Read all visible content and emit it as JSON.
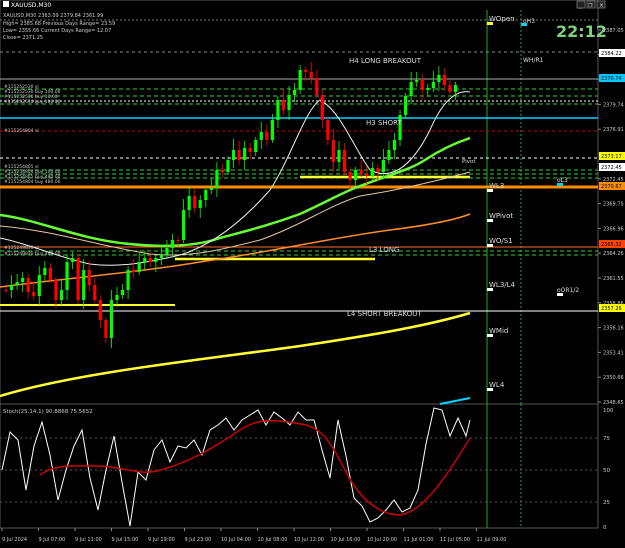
{
  "window": {
    "title": "XAUUSD,M30",
    "close_label": "×",
    "restore_label": "❐",
    "minimize_label": "_"
  },
  "info_lines": [
    "XAUUSD,M30  2363.09 2379.84 2361.99",
    "High= 2385.68   Previous Days Range= 23.59",
    "Low= 2355.66   Current Days Range= 12.07",
    "Close= 2371.25"
  ],
  "clock": "22:12",
  "chart_text": {
    "h4_long": "H4 LONG BREAKOUT",
    "h3_short": "H3 SHORT",
    "l3_long": "L3 LONG",
    "l4_short": "L4 SHORT BREAKOUT",
    "pivot": "Pivot",
    "wopen": "WOpen",
    "oh3": "oH3",
    "wh_r1": "WH/R1",
    "ol3": "oL3",
    "wl3": "WL3",
    "wpivot": "WPivot",
    "wo_s1": "WO/S1",
    "wl3_l4": "WL3/L4",
    "or1_2": "oOR1/2",
    "wmid": "WMid",
    "wl4": "WL4"
  },
  "orders": [
    "#115252530 sl",
    "#115252530 buy 100.00",
    "#115252530 buy 10.00",
    "#115252530 buy 100.00",
    "#115254804 sl",
    "#115254805 sl",
    "#115254804 buy 100.00",
    "#115254805 buy 480.00",
    "#115254804 buy 480.00",
    "#115249830 sl",
    "#115249830 buy 480.00"
  ],
  "price_axis": {
    "labels": [
      "2387.05",
      "2384.22",
      "2381.55",
      "2379.74",
      "2376.91",
      "2375.14",
      "2372.45",
      "2369.75",
      "2366.96",
      "2364.26",
      "2361.55",
      "2358.86",
      "2356.16",
      "2353.41",
      "2350.66",
      "2348.65"
    ],
    "badges": [
      {
        "text": "2384.22",
        "color": "#ffffff"
      },
      {
        "text": "2376.74",
        "color": "#00c8ff"
      },
      {
        "text": "2373.17",
        "color": "#ffff00"
      },
      {
        "text": "2372.45",
        "color": "#ffffff"
      },
      {
        "text": "2370.67",
        "color": "#ff8c00"
      },
      {
        "text": "2365.32",
        "color": "#ff4500"
      },
      {
        "text": "2357.26",
        "color": "#ffff00"
      }
    ]
  },
  "stoch": {
    "label": "Stoch(25,14,1) 90.8868 75.5652",
    "levels": [
      "100",
      "75",
      "50",
      "25",
      "0"
    ]
  },
  "time_axis": [
    "9 Jul 2024",
    "9 Jul 07:00",
    "9 Jul 11:00",
    "9 Jul 15:00",
    "9 Jul 19:00",
    "9 Jul 23:00",
    "10 Jul 04:00",
    "10 Jul 08:00",
    "10 Jul 12:00",
    "10 Jul 16:00",
    "10 Jul 20:00",
    "11 Jul 01:00",
    "11 Jul 05:00",
    "11 Jul 09:00"
  ],
  "colors": {
    "background": "#000000",
    "bull": "#00ff00",
    "bear": "#ff0000",
    "ma_green": "#66ff33",
    "ma_yellow": "#ffff33",
    "ma_orange": "#ff8c2a",
    "cyan": "#00d4ff",
    "stoch_main": "#ffffff",
    "stoch_signal": "#cc0000"
  }
}
